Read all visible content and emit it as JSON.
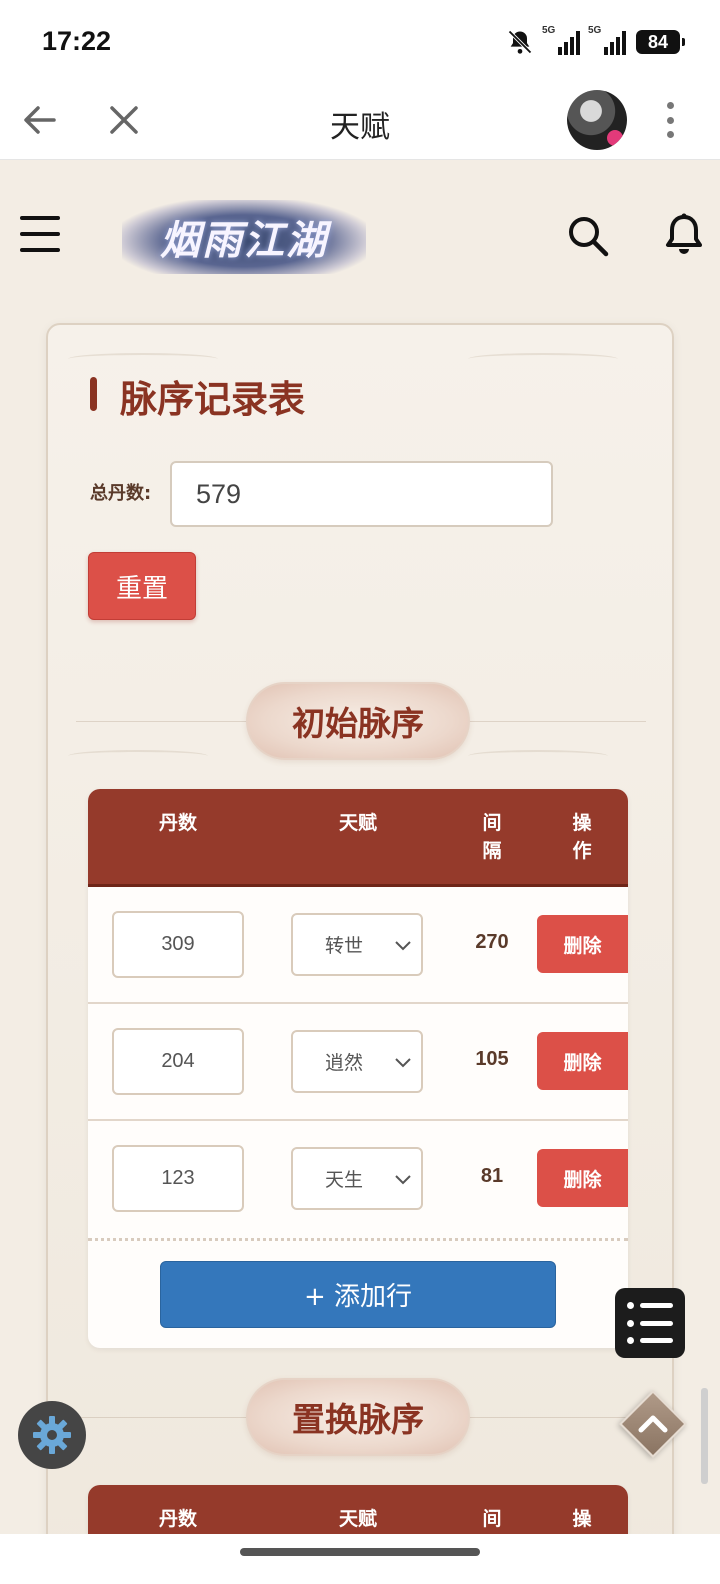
{
  "status_bar": {
    "time": "17:22",
    "signal1_label": "5G",
    "signal2_label": "5G",
    "battery": "84",
    "icons": [
      "bell-off-icon",
      "signal-icon",
      "signal-icon",
      "battery-icon"
    ]
  },
  "browser": {
    "title": "天赋",
    "back_icon": "arrow-left-icon",
    "close_icon": "close-icon",
    "more_icon": "more-vertical-icon"
  },
  "site": {
    "logo_text": "烟雨江湖",
    "icons": [
      "menu-icon",
      "search-icon",
      "bell-icon"
    ]
  },
  "page": {
    "title": "脉序记录表",
    "total_label": "总丹数:",
    "total_value": "579",
    "reset_label": "重置"
  },
  "section1": {
    "title": "初始脉序",
    "columns": {
      "dan": "丹数",
      "tian": "天赋",
      "jian": "间\n隔",
      "op": "操\n作"
    },
    "rows": [
      {
        "dan": "309",
        "talent": "转世",
        "gap": "270",
        "action": "删除"
      },
      {
        "dan": "204",
        "talent": "逍然",
        "gap": "105",
        "action": "删除"
      },
      {
        "dan": "123",
        "talent": "天生",
        "gap": "81",
        "action": "删除"
      }
    ],
    "add_row_label": "+ 添加行"
  },
  "section2": {
    "title": "置换脉序",
    "columns": {
      "dan": "丹数",
      "tian": "天赋",
      "jian": "间",
      "op": "操"
    }
  },
  "colors": {
    "primary": "#953a2b",
    "danger": "#dc5048",
    "info": "#3477bb",
    "background": "#f3ede4"
  }
}
